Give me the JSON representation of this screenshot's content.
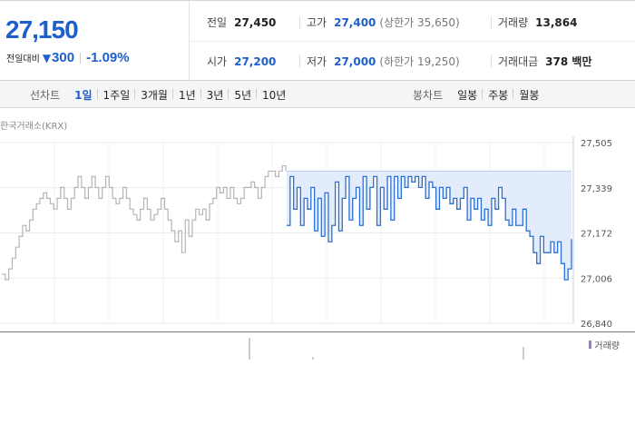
{
  "quote": {
    "price": "27,150",
    "diff_label": "전일대비",
    "diff_arrow": "▼",
    "diff_value": "300",
    "diff_pct": "-1.09%"
  },
  "stats": {
    "prev_close": {
      "label": "전일",
      "value": "27,450"
    },
    "high": {
      "label": "고가",
      "value": "27,400",
      "sub": "(상한가 35,650)"
    },
    "volume": {
      "label": "거래량",
      "value": "13,864"
    },
    "open": {
      "label": "시가",
      "value": "27,200"
    },
    "low": {
      "label": "저가",
      "value": "27,000",
      "sub": "(하한가 19,250)"
    },
    "amount": {
      "label": "거래대금",
      "value": "378 백만"
    }
  },
  "tabs": {
    "line_title": "선차트",
    "line_items": [
      "1일",
      "1주일",
      "3개월",
      "1년",
      "3년",
      "5년",
      "10년"
    ],
    "line_active": 0,
    "candle_title": "봉차트",
    "candle_items": [
      "일봉",
      "주봉",
      "월봉"
    ]
  },
  "chart": {
    "source": "한국거래소(KRX)",
    "volume_legend": "거래량",
    "colors": {
      "today": "#2c6fd6",
      "previous": "#b5b5b5",
      "fill": "#e3ecfa"
    }
  },
  "chart_data": {
    "type": "line",
    "title": "",
    "xlabel": "",
    "ylabel": "",
    "ylim": [
      26840,
      27505
    ],
    "y_ticks": [
      "27,505",
      "27,339",
      "27,172",
      "27,006",
      "26,840"
    ],
    "series": [
      {
        "values": [
          27020,
          27000,
          27040,
          27080,
          27120,
          27160,
          27200,
          27180,
          27220,
          27260,
          27280,
          27300,
          27320,
          27300,
          27280,
          27260,
          27300,
          27340,
          27300,
          27260,
          27300,
          27340,
          27380,
          27340,
          27300,
          27340,
          27380,
          27340,
          27300,
          27340,
          27380,
          27340,
          27300,
          27280,
          27300,
          27340,
          27300,
          27260,
          27240,
          27220,
          27260,
          27300,
          27260,
          27220,
          27240,
          27260,
          27300,
          27260,
          27220,
          27180,
          27140,
          27180,
          27100,
          27220,
          27160,
          27220,
          27260,
          27240,
          27260,
          27220,
          27280,
          27300,
          27340,
          27320,
          27340,
          27300,
          27340,
          27300,
          27280,
          27300,
          27340,
          27340,
          27360,
          27340,
          27300,
          27340,
          27380,
          27400,
          27400,
          27380,
          27400,
          27420,
          27400
        ]
      },
      {
        "values": [
          27200,
          27380,
          27260,
          27340,
          27200,
          27300,
          27260,
          27340,
          27180,
          27300,
          27160,
          27320,
          27140,
          27200,
          27360,
          27180,
          27300,
          27380,
          27220,
          27300,
          27340,
          27200,
          27380,
          27260,
          27340,
          27380,
          27200,
          27340,
          27260,
          27380,
          27220,
          27380,
          27300,
          27380,
          27340,
          27380,
          27360,
          27380,
          27340,
          27380,
          27300,
          27360,
          27340,
          27260,
          27340,
          27300,
          27340,
          27280,
          27300,
          27260,
          27300,
          27340,
          27220,
          27300,
          27260,
          27300,
          27220,
          27260,
          27200,
          27300,
          27260,
          27340,
          27300,
          27220,
          27200,
          27260,
          27200,
          27200,
          27260,
          27180,
          27160,
          27100,
          27060,
          27160,
          27100,
          27100,
          27140,
          27100,
          27140,
          27060,
          27000,
          27040,
          27150
        ]
      }
    ]
  }
}
